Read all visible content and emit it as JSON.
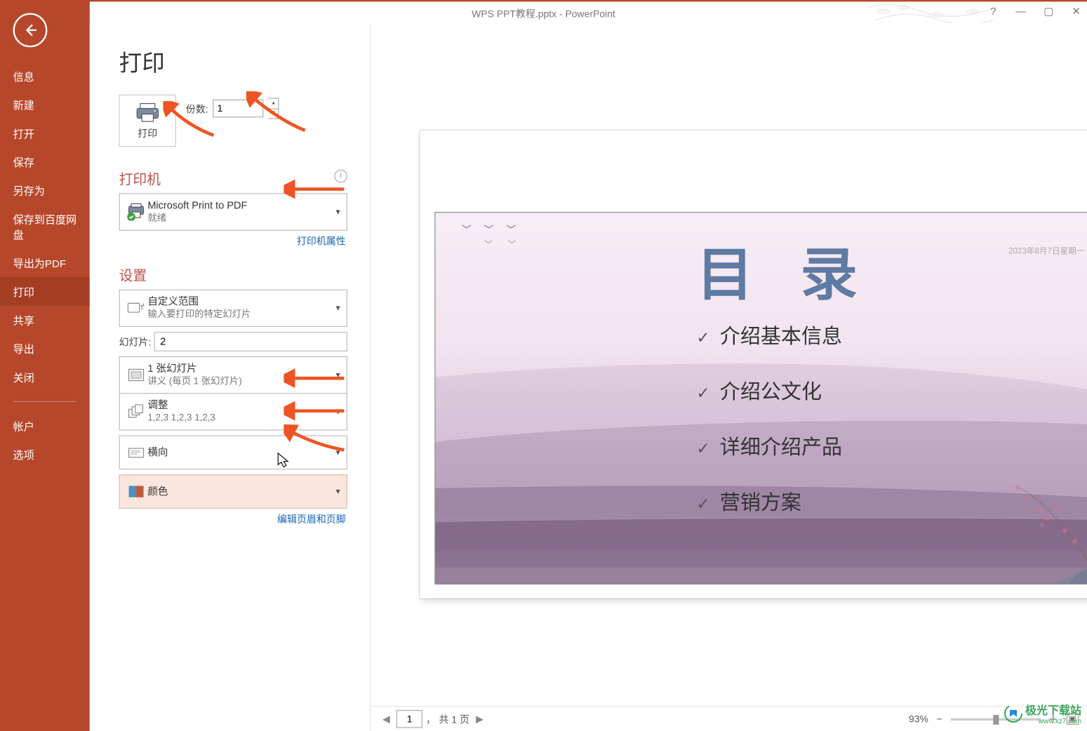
{
  "window": {
    "title": "WPS PPT教程.pptx - PowerPoint"
  },
  "sidebar": {
    "items": [
      {
        "label": "信息"
      },
      {
        "label": "新建"
      },
      {
        "label": "打开"
      },
      {
        "label": "保存"
      },
      {
        "label": "另存为"
      },
      {
        "label": "保存到百度网盘"
      },
      {
        "label": "导出为PDF"
      },
      {
        "label": "打印"
      },
      {
        "label": "共享"
      },
      {
        "label": "导出"
      },
      {
        "label": "关闭"
      }
    ],
    "items2": [
      {
        "label": "帐户"
      },
      {
        "label": "选项"
      }
    ],
    "active_index": 7
  },
  "print": {
    "heading": "打印",
    "button_label": "打印",
    "copies_label": "份数:",
    "copies_value": "1"
  },
  "printer": {
    "section": "打印机",
    "name": "Microsoft Print to PDF",
    "status": "就绪",
    "properties_link": "打印机属性"
  },
  "settings": {
    "section": "设置",
    "range": {
      "primary": "自定义范围",
      "secondary": "输入要打印的特定幻灯片"
    },
    "slides_label": "幻灯片:",
    "slides_value": "2",
    "layout": {
      "primary": "1 张幻灯片",
      "secondary": "讲义 (每页 1 张幻灯片)"
    },
    "collate": {
      "primary": "调整",
      "secondary": "1,2,3    1,2,3    1,2,3"
    },
    "orientation": {
      "primary": "横向"
    },
    "color": {
      "primary": "颜色"
    },
    "header_footer_link": "编辑页眉和页脚"
  },
  "slide": {
    "title": "目 录",
    "date": "2023年8月7日星期一",
    "toc": [
      "介绍基本信息",
      "介绍公文化",
      "详细介绍产品",
      "营销方案"
    ]
  },
  "status": {
    "page_input": "1",
    "page_total": "共 1 页",
    "page_sep": "，",
    "zoom": "93%"
  },
  "watermark": {
    "text": "极光下载站",
    "url": "www.xz7.com"
  }
}
